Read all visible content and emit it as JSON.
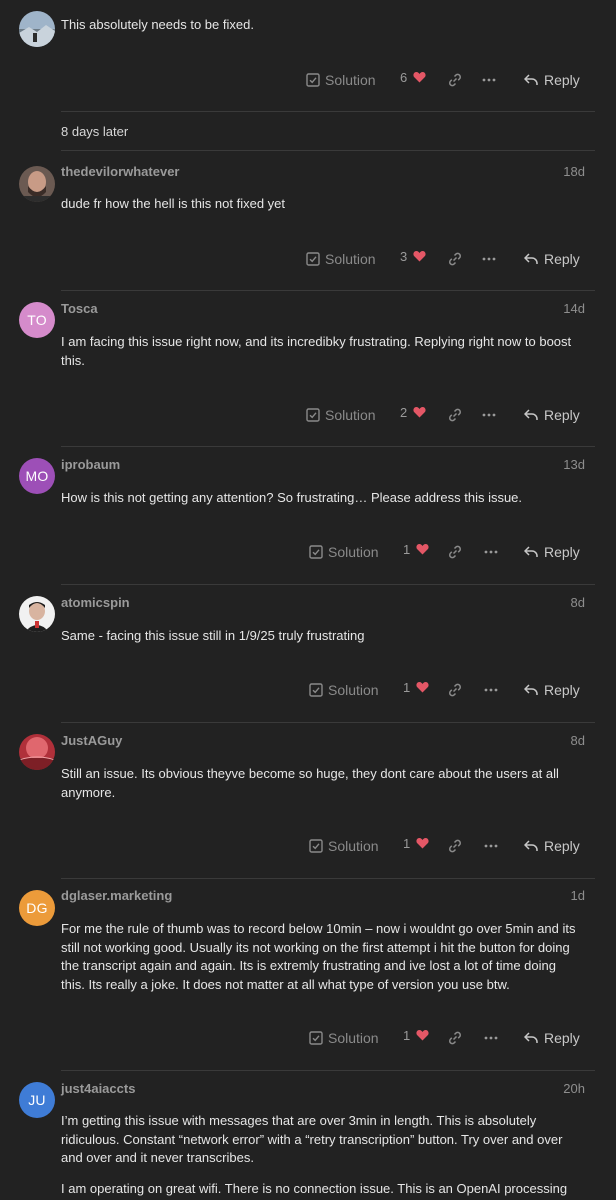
{
  "gap_notice": "8 days later",
  "action_labels": {
    "solution": "Solution",
    "reply": "Reply"
  },
  "icons": {
    "solution": "check-square-icon",
    "like": "heart-icon",
    "link": "link-icon",
    "more": "ellipsis-icon",
    "reply": "reply-arrow-icon"
  },
  "colors": {
    "background": "#222222",
    "heart": "#e45766",
    "divider": "#3a3a3a"
  },
  "posts": [
    {
      "username": "",
      "date": "",
      "avatar_initials": "",
      "avatar_color": "",
      "body": [
        "This absolutely needs to be fixed."
      ],
      "likes": "6"
    },
    {
      "username": "thedevilorwhatever",
      "date": "18d",
      "avatar_initials": "",
      "avatar_color": "",
      "body": [
        "dude fr how the hell is this not fixed yet"
      ],
      "likes": "3"
    },
    {
      "username": "Tosca",
      "date": "14d",
      "avatar_initials": "TO",
      "avatar_color": "#d58bcb",
      "body": [
        "I am facing this issue right now, and its incredibky frustrating. Replying right now to boost this."
      ],
      "likes": "2"
    },
    {
      "username": "iprobaum",
      "date": "13d",
      "avatar_initials": "MO",
      "avatar_color": "#9d4fb7",
      "body": [
        "How is this not getting any attention? So frustrating… Please address this issue."
      ],
      "likes": "1"
    },
    {
      "username": "atomicspin",
      "date": "8d",
      "avatar_initials": "",
      "avatar_color": "",
      "body": [
        "Same - facing this issue still in 1/9/25 truly frustrating"
      ],
      "likes": "1"
    },
    {
      "username": "JustAGuy",
      "date": "8d",
      "avatar_initials": "",
      "avatar_color": "",
      "body": [
        "Still an issue. Its obvious theyve become so huge, they dont care about the users at all anymore."
      ],
      "likes": "1"
    },
    {
      "username": "dglaser.marketing",
      "date": "1d",
      "avatar_initials": "DG",
      "avatar_color": "#ec9b3a",
      "body": [
        "For me the rule of thumb was to record below 10min – now i wouldnt go over 5min and its still not working good. Usually its not working on the first attempt i hit the button for doing the transcript again and again. Its is extremly frustrating and ive lost a lot of time doing this. Its really a joke. It does not matter at all what type of version you use btw."
      ],
      "likes": "1"
    },
    {
      "username": "just4aiaccts",
      "date": "20h",
      "avatar_initials": "JU",
      "avatar_color": "#3f7cd6",
      "body": [
        "I’m getting this issue with messages that are over 3min in length. This is absolutely ridiculous. Constant “network error” with a “retry transcription” button. Try over and over and over and it never transcribes.",
        "I am operating on great wifi. There is no connection issue. This is an OpenAI processing"
      ],
      "likes": ""
    }
  ]
}
